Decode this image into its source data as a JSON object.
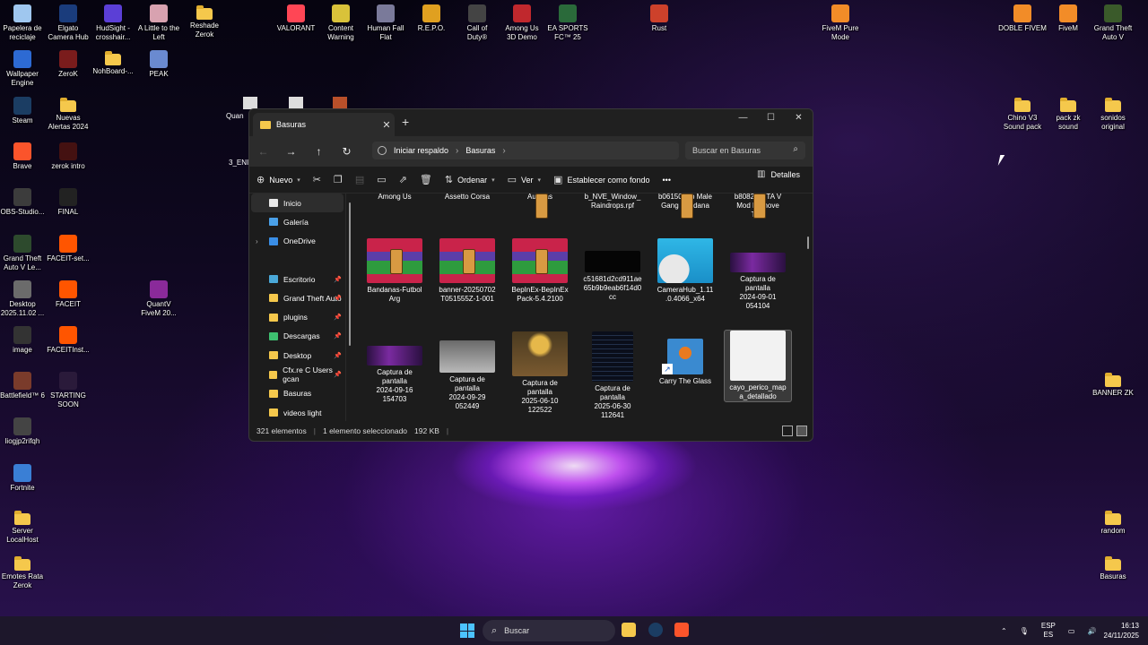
{
  "desktop": {
    "icons_left": [
      {
        "label": "Papelera de\nreciclaje",
        "color": "#9fc7ef"
      },
      {
        "label": "Wallpaper\nEngine",
        "color": "#2d6ad3"
      },
      {
        "label": "Steam",
        "color": "#1b3d63"
      },
      {
        "label": "Brave",
        "color": "#fb542b"
      },
      {
        "label": "OBS-Studio...",
        "color": "#3c3c3c"
      },
      {
        "label": "Grand Theft\nAuto V Le...",
        "color": "#2d4a2d"
      },
      {
        "label": "Desktop\n2025.11.02 ...",
        "color": "#6b6b6b"
      },
      {
        "label": "image",
        "color": "#333333"
      },
      {
        "label": "Battlefield™ 6",
        "color": "#7a3b2b"
      },
      {
        "label": "liogjp2rifqh",
        "color": "#444444"
      },
      {
        "label": "Fortnite",
        "color": "#3a7fd5"
      },
      {
        "label": "Server\nLocalHost",
        "color": "#f5c84c"
      },
      {
        "label": "Emotes Rata\nZerok",
        "color": "#f5c84c"
      }
    ],
    "icons_col2": [
      {
        "label": "Elgato\nCamera Hub",
        "color": "#1a3c7c"
      },
      {
        "label": "ZeroK",
        "color": "#7a1c1c"
      },
      {
        "label": "Nuevas\nAlertas 2024",
        "color": "#f5c84c"
      },
      {
        "label": "zerok intro",
        "color": "#441111"
      },
      {
        "label": "FINAL",
        "color": "#222222"
      },
      {
        "label": "FACEIT-set...",
        "color": "#ff5500"
      },
      {
        "label": "FACEIT",
        "color": "#ff5500"
      },
      {
        "label": "FACEITInst...",
        "color": "#ff5500"
      },
      {
        "label": "STARTING\nSOON",
        "color": "#2a1a3a"
      }
    ],
    "icons_top": [
      {
        "label": "HudSight -\ncrosshair...",
        "color": "#5b3fd6"
      },
      {
        "label": "A Little to the\nLeft",
        "color": "#d8a2b0"
      },
      {
        "label": "Reshade\nZerok",
        "color": "#f5c84c"
      },
      {
        "label": "NohBoard-...",
        "color": "#f5c84c"
      },
      {
        "label": "PEAK",
        "color": "#6a8ad0"
      },
      {
        "label": "VALORANT",
        "color": "#ff4655"
      },
      {
        "label": "Content\nWarning",
        "color": "#d9c23a"
      },
      {
        "label": "Human Fall\nFlat",
        "color": "#7a7a9a"
      },
      {
        "label": "R.E.P.O.",
        "color": "#e0a020"
      },
      {
        "label": "Call of\nDuty®",
        "color": "#444444"
      },
      {
        "label": "Among Us\n3D Demo",
        "color": "#c0282d"
      },
      {
        "label": "EA SPORTS\nFC™ 25",
        "color": "#2a6a3a"
      },
      {
        "label": "Rust",
        "color": "#cd412b"
      },
      {
        "label": "FiveM Pure\nMode",
        "color": "#f28c28"
      },
      {
        "label": "DOBLE FIVEM",
        "color": "#f28c28"
      },
      {
        "label": "FiveM",
        "color": "#f28c28"
      },
      {
        "label": "Grand Theft\nAuto V",
        "color": "#3a5a2a"
      },
      {
        "label": "QuantV\nFiveM 20...",
        "color": "#8a2a9a"
      }
    ],
    "icons_right": [
      {
        "label": "Chino V3\nSound pack"
      },
      {
        "label": "pack zk\nsound"
      },
      {
        "label": "sonidos\noriginal"
      },
      {
        "label": "BANNER ZK"
      },
      {
        "label": "random"
      },
      {
        "label": "Basuras"
      }
    ],
    "partial_labels": [
      "Quan",
      "3_ENI"
    ]
  },
  "explorer": {
    "tab_title": "Basuras",
    "new_tab": "+",
    "window_buttons": [
      "—",
      "☐",
      "✕"
    ],
    "breadcrumb": [
      "Iniciar respaldo",
      "Basuras"
    ],
    "search_placeholder": "Buscar en Basuras",
    "toolbar": {
      "new": "Nuevo",
      "sort": "Ordenar",
      "view": "Ver",
      "set_bg": "Establecer como fondo",
      "more": "•••",
      "details": "Detalles"
    },
    "sidebar": [
      {
        "label": "Inicio",
        "color": "#e8e8e8",
        "active": true
      },
      {
        "label": "Galería",
        "color": "#4aa0e8"
      },
      {
        "label": "OneDrive",
        "color": "#3a8ee6",
        "expand": true
      },
      {
        "label": "Escritorio",
        "color": "#4aa8d8",
        "pinned": true
      },
      {
        "label": "Grand Theft Auto",
        "color": "#f5c84c",
        "pinned": true
      },
      {
        "label": "plugins",
        "color": "#f5c84c",
        "pinned": true
      },
      {
        "label": "Descargas",
        "color": "#3ec070",
        "pinned": true
      },
      {
        "label": "Desktop",
        "color": "#f5c84c",
        "pinned": true
      },
      {
        "label": "Cfx.re  C  Users gcan",
        "color": "#f5c84c",
        "pinned": true
      },
      {
        "label": "Basuras",
        "color": "#f5c84c"
      },
      {
        "label": "videos light",
        "color": "#f5c84c"
      }
    ],
    "files": [
      {
        "name": "Among Us",
        "kind": "shortcut-top"
      },
      {
        "name": "Assetto Corsa",
        "kind": "shortcut-top"
      },
      {
        "name": "Auroras",
        "kind": "rar-top"
      },
      {
        "name": "b_NVE_Window_\nRaindrops.rpf",
        "kind": "white-top"
      },
      {
        "name": "b06150-Mp Male\nGang Bandana",
        "kind": "rar-top"
      },
      {
        "name": "b80822-GTA V\nMod Remove\nTool",
        "kind": "rar-top"
      },
      {
        "name": "Bandanas-Futbol\nArg",
        "kind": "rar"
      },
      {
        "name": "banner-20250702\nT051555Z-1-001",
        "kind": "rar"
      },
      {
        "name": "BepInEx-BepInEx\nPack-5.4.2100",
        "kind": "rar"
      },
      {
        "name": "c51681d2cd911ae\n65b9b9eab6f14d0\ncc",
        "kind": "black"
      },
      {
        "name": "CameraHub_1.11\n.0.4066_x64",
        "kind": "installer"
      },
      {
        "name": "Captura de\npantalla\n2024-09-01\n054104",
        "kind": "zk"
      },
      {
        "name": "Captura de\npantalla\n2024-09-16\n154703",
        "kind": "zk"
      },
      {
        "name": "Captura de\npantalla\n2024-09-29\n052449",
        "kind": "photo-gray"
      },
      {
        "name": "Captura de\npantalla\n2025-06-10\n122522",
        "kind": "photo-dogs"
      },
      {
        "name": "Captura de\npantalla\n2025-06-30\n112641",
        "kind": "dark-list"
      },
      {
        "name": "Carry The Glass",
        "kind": "game"
      },
      {
        "name": "cayo_perico_map\na_detallado",
        "kind": "map",
        "selected": true
      }
    ],
    "status": {
      "count": "321 elementos",
      "selection": "1 elemento seleccionado",
      "size": "192 KB"
    }
  },
  "taskbar": {
    "search_placeholder": "Buscar",
    "lang_top": "ESP",
    "lang_bottom": "ES",
    "time": "16:13",
    "date": "24/11/2025",
    "colors": {
      "start": "#4cc2ff",
      "explorer": "#f5c84c",
      "steam": "#1b3d63",
      "brave": "#fb542b"
    }
  }
}
